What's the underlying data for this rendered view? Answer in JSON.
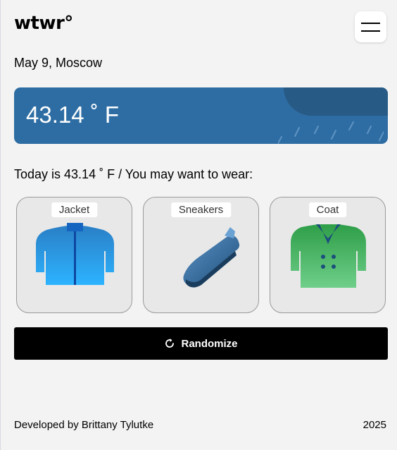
{
  "header": {
    "logo": "wtwr°",
    "menu_icon": "hamburger-icon"
  },
  "date_location": "May 9, Moscow",
  "weather": {
    "temp": "43.14 ˚ F",
    "condition": "rain"
  },
  "recommendation": "Today is 43.14 ˚ F / You may want to wear:",
  "items": [
    {
      "label": "Jacket",
      "icon": "jacket-icon"
    },
    {
      "label": "Sneakers",
      "icon": "sneakers-icon"
    },
    {
      "label": "Coat",
      "icon": "coat-icon"
    }
  ],
  "randomize": {
    "label": "Randomize",
    "icon": "refresh-icon"
  },
  "footer": {
    "credit": "Developed by Brittany Tylutke",
    "year": "2025"
  },
  "colors": {
    "weather_card": "#2e6da3",
    "cloud": "#275a85",
    "button": "#000000"
  }
}
